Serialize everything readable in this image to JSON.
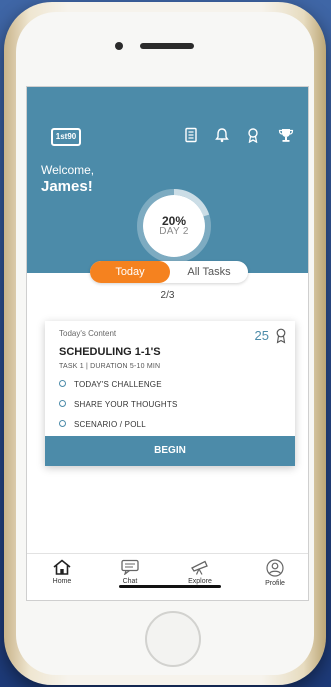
{
  "header": {
    "logo_text": "1st90",
    "welcome": "Welcome,",
    "user_name": "James!",
    "progress_percent": "20%",
    "day_label": "DAY 2",
    "progress_value": 0.2
  },
  "icons": {
    "top": [
      "notes-icon",
      "bell-icon",
      "badge-icon",
      "trophy-icon"
    ]
  },
  "tabs": {
    "today": "Today",
    "all_tasks": "All Tasks",
    "active": "Today"
  },
  "counter": "2/3",
  "card": {
    "label": "Today's Content",
    "points": "25",
    "title": "SCHEDULING 1-1'S",
    "subtitle": "TASK 1 | DURATION 5-10 MIN",
    "items": [
      "TODAY'S CHALLENGE",
      "SHARE YOUR THOUGHTS",
      "SCENARIO / POLL"
    ],
    "action": "BEGIN"
  },
  "nav": {
    "home": "Home",
    "chat": "Chat",
    "explore": "Explore",
    "profile": "Profile"
  },
  "colors": {
    "header": "#4c8ba9",
    "accent": "#f5821f",
    "button": "#4c8ba9"
  }
}
